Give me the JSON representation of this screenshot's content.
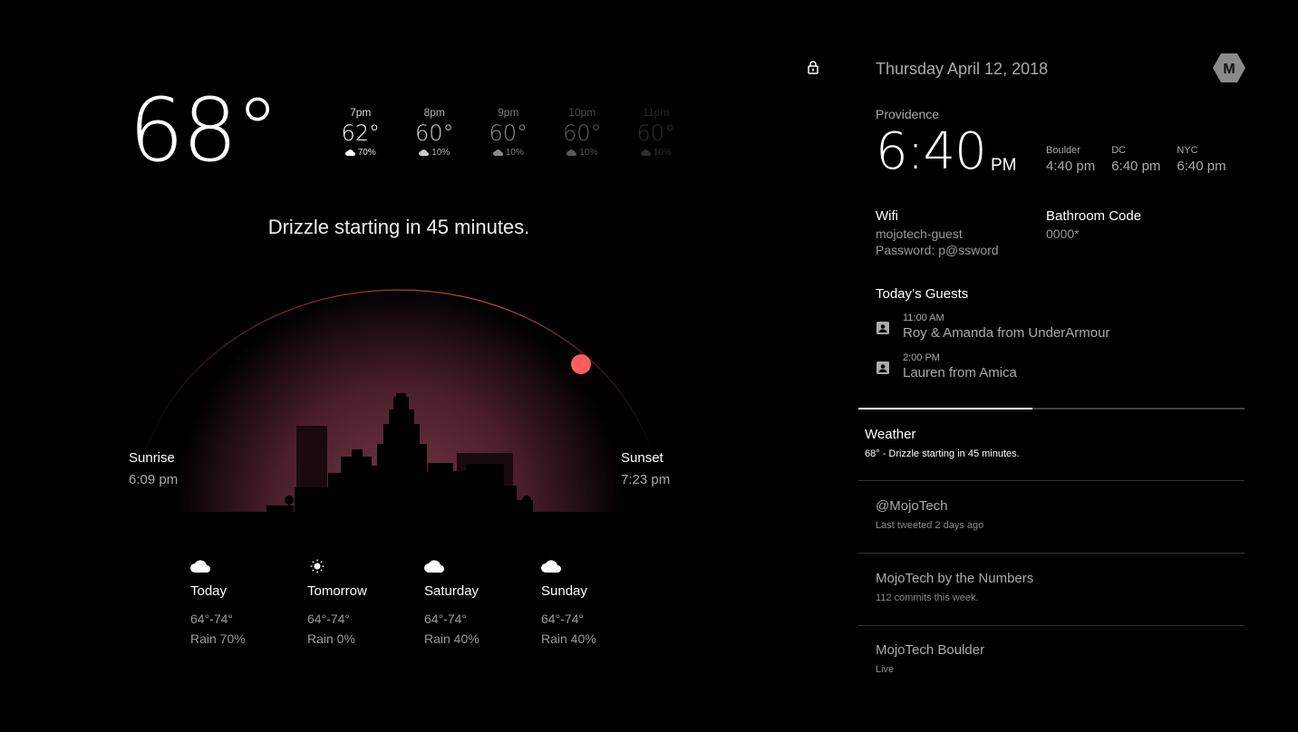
{
  "weather": {
    "current_temp": "68°",
    "hourly": [
      {
        "time": "7pm",
        "temp": "62°",
        "rain": "70%"
      },
      {
        "time": "8pm",
        "temp": "60°",
        "rain": "10%"
      },
      {
        "time": "9pm",
        "temp": "60°",
        "rain": "10%"
      },
      {
        "time": "10pm",
        "temp": "60°",
        "rain": "10%"
      },
      {
        "time": "11pm",
        "temp": "60°",
        "rain": "10%"
      }
    ],
    "summary": "Drizzle starting in 45 minutes.",
    "sunrise_label": "Sunrise",
    "sunrise_time": "6:09 pm",
    "sunset_label": "Sunset",
    "sunset_time": "7:23 pm",
    "sun_progress": 0.72,
    "colors": {
      "arc": "#b2403f",
      "sun": "#ff5d5d",
      "glow": "#6a2e3c"
    },
    "forecast": [
      {
        "icon": "cloud-icon",
        "day": "Today",
        "range": "64°-74°",
        "rain": "Rain 70%"
      },
      {
        "icon": "sun-icon",
        "day": "Tomorrow",
        "range": "64°-74°",
        "rain": "Rain 0%"
      },
      {
        "icon": "cloud-icon",
        "day": "Saturday",
        "range": "64°-74°",
        "rain": "Rain 40%"
      },
      {
        "icon": "cloud-icon",
        "day": "Sunday",
        "range": "64°-74°",
        "rain": "Rain 40%"
      }
    ]
  },
  "header": {
    "date": "Thursday April 12, 2018",
    "logo_letter": "M"
  },
  "clock": {
    "city": "Providence",
    "time": "6:40",
    "ampm": "PM",
    "zones": [
      {
        "name": "Boulder",
        "time": "4:40 pm"
      },
      {
        "name": "DC",
        "time": "6:40 pm"
      },
      {
        "name": "NYC",
        "time": "6:40 pm"
      }
    ]
  },
  "wifi": {
    "label": "Wifi",
    "network": "mojotech-guest",
    "password": "Password: p@ssword"
  },
  "bathroom": {
    "label": "Bathroom Code",
    "code": "0000*"
  },
  "guests": {
    "title": "Today’s Guests",
    "items": [
      {
        "time": "11:00 AM",
        "name": "Roy & Amanda from UnderArmour"
      },
      {
        "time": "2:00 PM",
        "name": "Lauren from Amica"
      }
    ]
  },
  "rotation_progress": 0.45,
  "cards": [
    {
      "title": "Weather",
      "subtitle": "68°  -  Drizzle starting in 45 minutes.",
      "active": true
    },
    {
      "title": "@MojoTech",
      "subtitle": "Last tweeted 2 days ago",
      "active": false
    },
    {
      "title": "MojoTech by the Numbers",
      "subtitle": "112 commits this week.",
      "active": false
    },
    {
      "title": "MojoTech Boulder",
      "subtitle": "Live",
      "active": false
    }
  ]
}
